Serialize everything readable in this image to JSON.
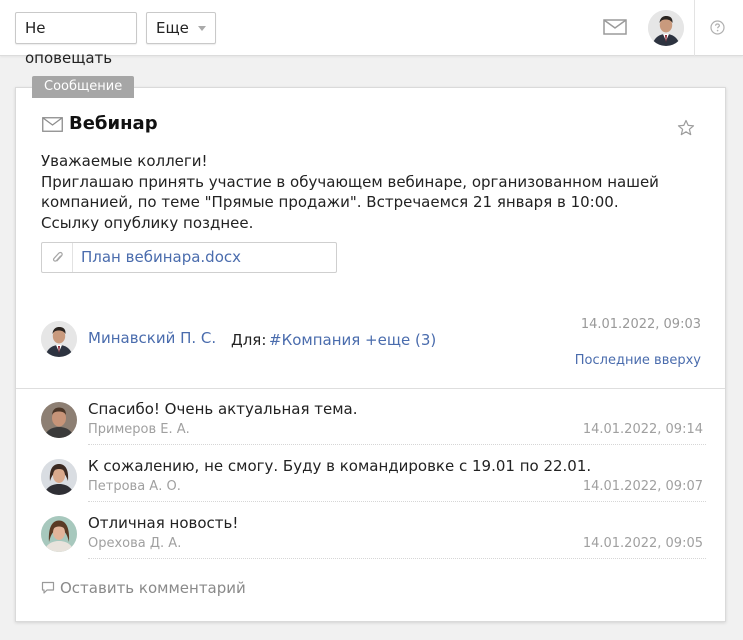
{
  "toolbar": {
    "mute_label": "Не оповещать",
    "more_label": "Еще",
    "icons": [
      "mail-icon",
      "avatar",
      "help-icon"
    ]
  },
  "post": {
    "tag": "Сообщение",
    "title": "Вебинар",
    "body": [
      "Уважаемые коллеги!",
      "Приглашаю принять участие в обучающем вебинаре, организованном нашей компанией, по теме \"Прямые продажи\". Встречаемся 21 января в 10:00. Ссылку опублику позднее."
    ],
    "attachment": "План вебинара.docx",
    "author": "Минавский П. С.",
    "to_label": "Для:",
    "to_value": "#Компания +еще (3)",
    "date": "14.01.2022, 09:03",
    "sort_label": "Последние вверху"
  },
  "comments": [
    {
      "text": "Спасибо! Очень актуальная тема.",
      "author": "Примеров Е. А.",
      "date": "14.01.2022, 09:14"
    },
    {
      "text": "К сожалению, не смогу. Буду в командировке с 19.01 по 22.01.",
      "author": "Петрова А. О.",
      "date": "14.01.2022, 09:07"
    },
    {
      "text": "Отличная новость!",
      "author": "Орехова Д. А.",
      "date": "14.01.2022, 09:05"
    }
  ],
  "leave_comment_label": "Оставить комментарий",
  "colors": {
    "link": "#4a6cad",
    "muted": "#a0a0a0",
    "tag_bg": "#a6a6a6",
    "page_bg": "#f1f1f1"
  }
}
